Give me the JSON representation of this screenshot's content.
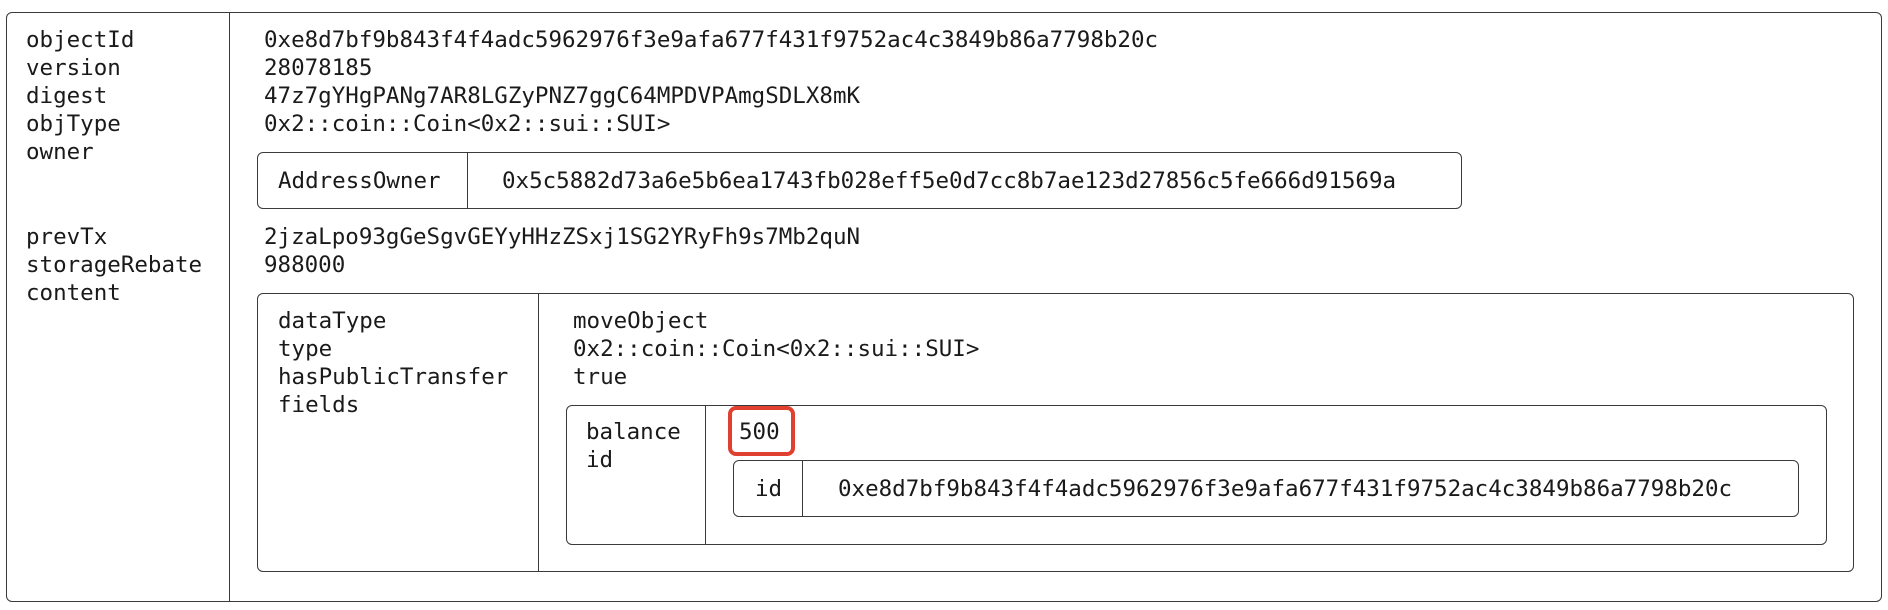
{
  "object": {
    "keys": [
      "objectId",
      "version",
      "digest",
      "objType",
      "owner",
      "prevTx",
      "storageRebate",
      "content"
    ],
    "objectId": "0xe8d7bf9b843f4f4adc5962976f3e9afa677f431f9752ac4c3849b86a7798b20c",
    "version": "28078185",
    "digest": "47z7gYHgPANg7AR8LGZyPNZ7ggC64MPDVPAmgSDLX8mK",
    "objType": "0x2::coin::Coin<0x2::sui::SUI>",
    "owner": {
      "key": "AddressOwner",
      "value": "0x5c5882d73a6e5b6ea1743fb028eff5e0d7cc8b7ae123d27856c5fe666d91569a"
    },
    "prevTx": "2jzaLpo93gGeSgvGEYyHHzZSxj1SG2YRyFh9s7Mb2quN",
    "storageRebate": "988000"
  },
  "content": {
    "keys": [
      "dataType",
      "type",
      "hasPublicTransfer",
      "fields"
    ],
    "dataType": "moveObject",
    "type": "0x2::coin::Coin<0x2::sui::SUI>",
    "hasPublicTransfer": "true"
  },
  "fields": {
    "keys": [
      "balance",
      "id"
    ],
    "balance": "500",
    "id": {
      "key": "id",
      "value": "0xe8d7bf9b843f4f4adc5962976f3e9afa677f431f9752ac4c3849b86a7798b20c"
    }
  },
  "highlight_color": "#e0402f"
}
